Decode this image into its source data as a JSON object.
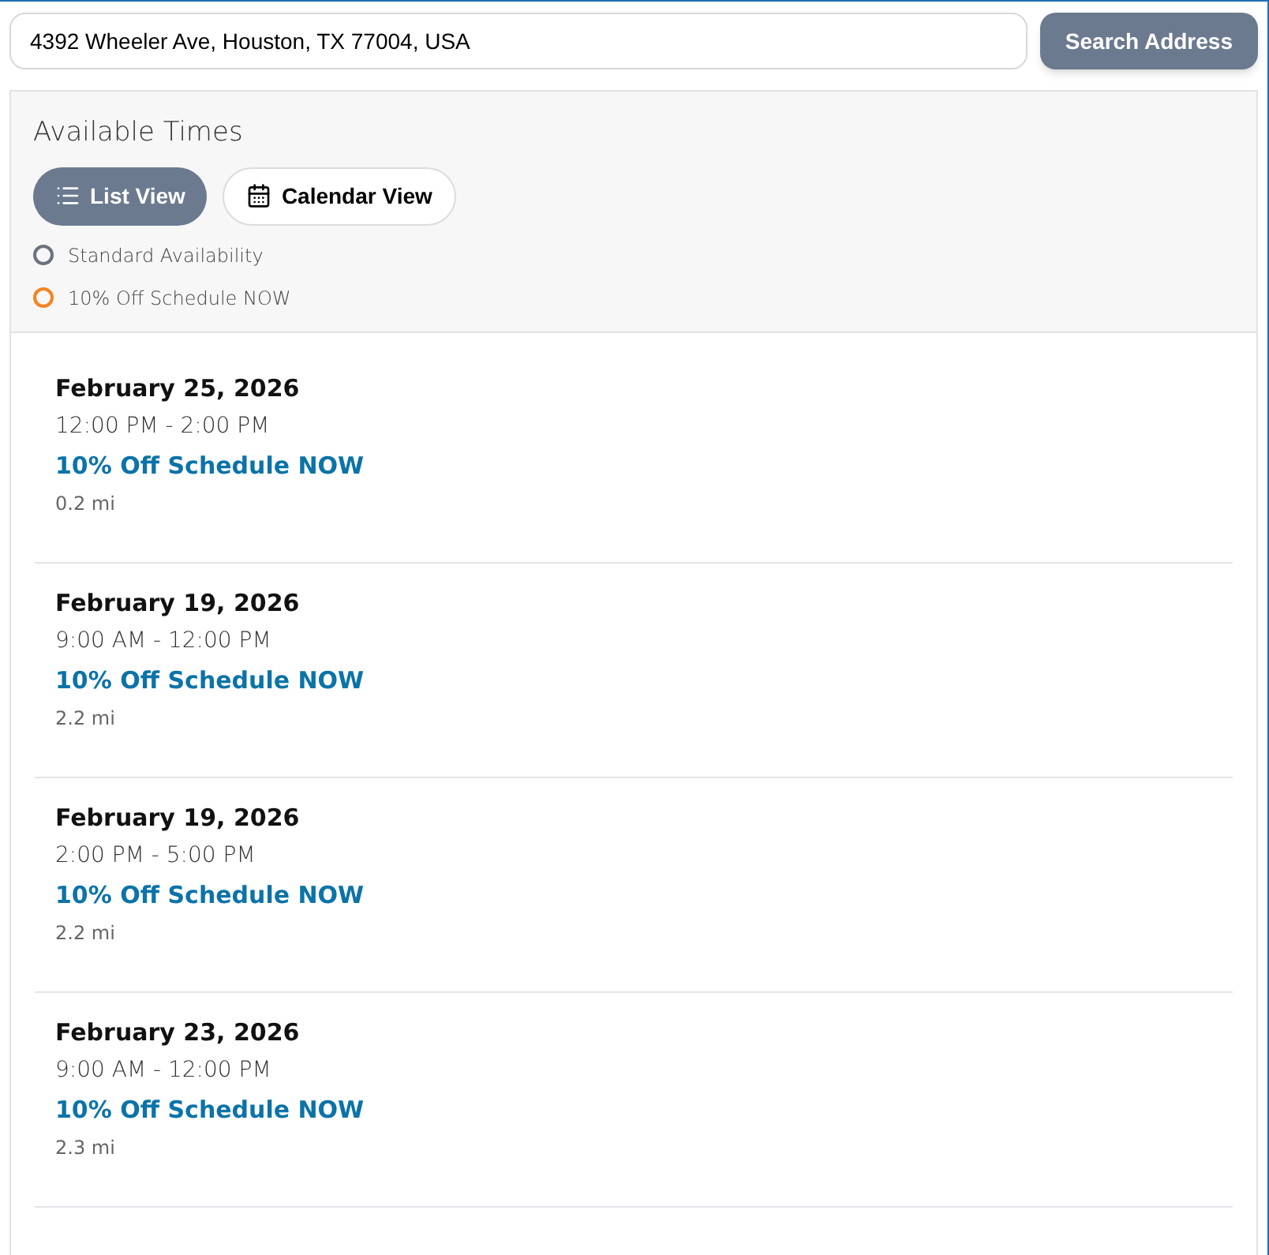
{
  "search": {
    "value": "4392 Wheeler Ave, Houston, TX 77004, USA",
    "button": "Search Address"
  },
  "panel": {
    "title": "Available Times",
    "views": [
      {
        "label": "List View",
        "kind": "list",
        "selected": true
      },
      {
        "label": "Calendar View",
        "kind": "calendar",
        "selected": false
      }
    ],
    "legend": [
      {
        "label": "Standard Availability",
        "color": "#6b7280"
      },
      {
        "label": "10% Off Schedule NOW",
        "color": "#f58220"
      }
    ]
  },
  "slots": [
    {
      "date": "February 25, 2026",
      "time": "12:00 PM - 2:00 PM",
      "offer": "10% Off Schedule NOW",
      "distance": "0.2 mi"
    },
    {
      "date": "February 19, 2026",
      "time": "9:00 AM - 12:00 PM",
      "offer": "10% Off Schedule NOW",
      "distance": "2.2 mi"
    },
    {
      "date": "February 19, 2026",
      "time": "2:00 PM - 5:00 PM",
      "offer": "10% Off Schedule NOW",
      "distance": "2.2 mi"
    },
    {
      "date": "February 23, 2026",
      "time": "9:00 AM - 12:00 PM",
      "offer": "10% Off Schedule NOW",
      "distance": "2.3 mi"
    }
  ]
}
